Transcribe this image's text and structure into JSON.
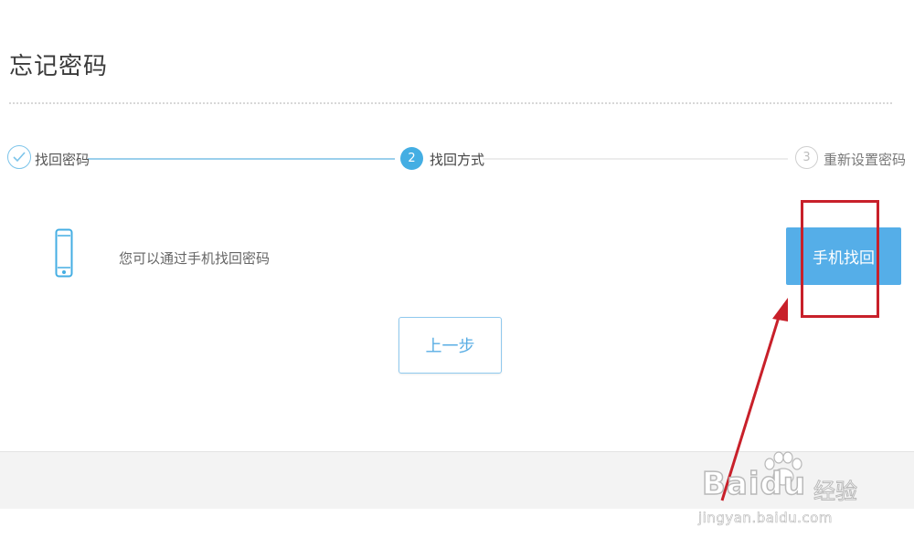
{
  "page": {
    "title": "忘记密码"
  },
  "steps": [
    {
      "index": "",
      "label": "找回密码",
      "state": "done"
    },
    {
      "index": "2",
      "label": "找回方式",
      "state": "current"
    },
    {
      "index": "3",
      "label": "重新设置密码",
      "state": "todo"
    }
  ],
  "method": {
    "icon": "phone-icon",
    "description": "您可以通过手机找回密码",
    "button_label": "手机找回"
  },
  "actions": {
    "prev_label": "上一步"
  },
  "watermark": {
    "logo": "Baidu",
    "brand_cn": "经验",
    "url": "jingyan.baidu.com"
  },
  "colors": {
    "accent": "#44aee3",
    "button": "#55aee8",
    "annotation": "#c8202a"
  }
}
